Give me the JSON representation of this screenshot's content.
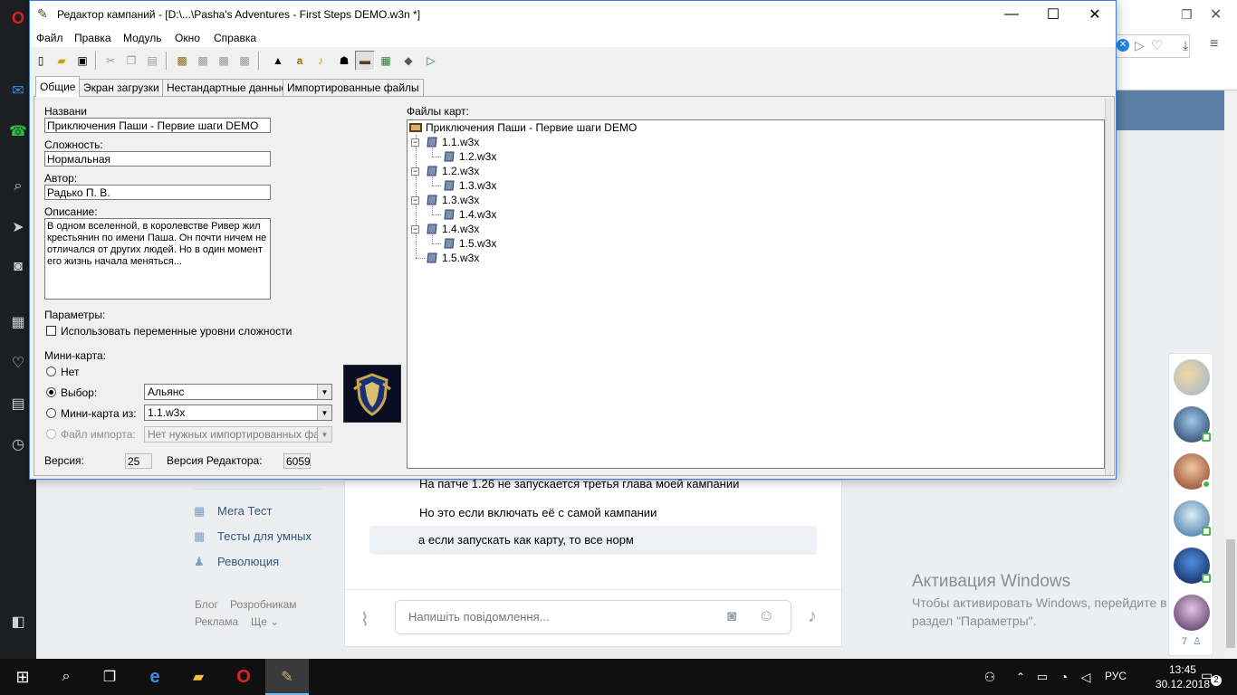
{
  "window": {
    "title": "Редактор кампаний - [D:\\...\\Pasha's Adventures - First Steps DEMO.w3n *]"
  },
  "menu": [
    "Файл",
    "Правка",
    "Модуль",
    "Окно",
    "Справка"
  ],
  "tabs": [
    "Общие",
    "Экран загрузки",
    "Нестандартные данные",
    "Импортированные файлы"
  ],
  "general": {
    "name_label": "Названи",
    "name_value": "Приключения Паши - Первие шаги DEMO",
    "difficulty_label": "Сложность:",
    "difficulty_value": "Нормальная",
    "author_label": "Автор:",
    "author_value": "Радько П. В.",
    "description_label": "Описание:",
    "description_value": "В одном вселенной, в королевстве Ривер жил крестьянин по имени Паша. Он почти ничем не отличался от других людей. Но в один момент его жизнь начала меняться...",
    "params_label": "Параметры:",
    "variable_difficulty_label": "Использовать переменные уровни сложности",
    "minimap_label": "Мини-карта:",
    "option_none": "Нет",
    "option_choice": "Выбор:",
    "option_choice_value": "Альянс",
    "option_from_map": "Мини-карта из:",
    "option_from_map_value": "1.1.w3x",
    "option_import": "Файл импорта:",
    "option_import_value": "Нет нужных импортированных файлов",
    "version_label": "Версия:",
    "version_value": "25",
    "editor_version_label": "Версия Редактора:",
    "editor_version_value": "6059"
  },
  "map_files": {
    "label": "Файлы карт:",
    "root": "Приключения Паши - Первие шаги DEMO",
    "items": [
      "1.1.w3x",
      "1.2.w3x",
      "1.2.w3x",
      "1.3.w3x",
      "1.3.w3x",
      "1.4.w3x",
      "1.4.w3x",
      "1.5.w3x",
      "1.5.w3x"
    ]
  },
  "vk": {
    "menu": [
      "Мега Тест",
      "Тесты для умных",
      "Революция"
    ],
    "footer": [
      "Блог",
      "Розробникам",
      "Реклама",
      "Ще ⌄"
    ],
    "messages": [
      "На патче 1.26 не запускается третья глава моей кампании",
      "Но это если включать её с самой кампании",
      "а если запускать как карту, то все норм"
    ],
    "composer_placeholder": "Напишіть повідомлення...",
    "online_count": "7"
  },
  "activation": {
    "title": "Активация Windows",
    "text": "Чтобы активировать Windows, перейдите в раздел \"Параметры\"."
  },
  "taskbar": {
    "lang": "РУС",
    "time": "13:45",
    "date": "30.12.2018",
    "notifications": "2"
  }
}
